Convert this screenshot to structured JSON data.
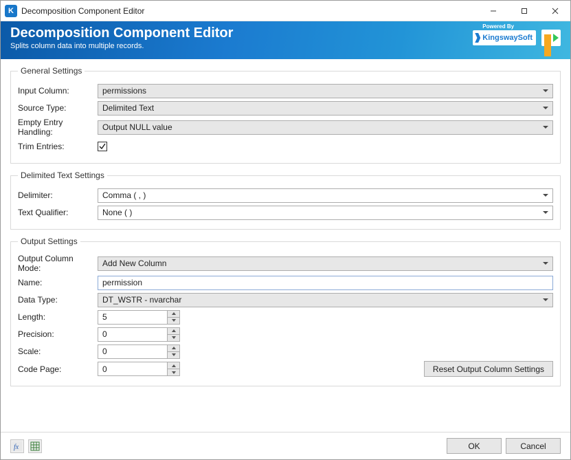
{
  "titlebar": {
    "app_initial": "K",
    "title": "Decomposition Component Editor"
  },
  "banner": {
    "title": "Decomposition Component Editor",
    "subtitle": "Splits column data into multiple records.",
    "powered_by": "Powered By",
    "brand": "KingswaySoft"
  },
  "general": {
    "legend": "General Settings",
    "input_column_label": "Input Column:",
    "input_column_value": "permissions",
    "source_type_label": "Source Type:",
    "source_type_value": "Delimited Text",
    "empty_handling_label": "Empty Entry Handling:",
    "empty_handling_value": "Output NULL value",
    "trim_label": "Trim Entries:",
    "trim_checked": true
  },
  "delimited": {
    "legend": "Delimited Text Settings",
    "delimiter_label": "Delimiter:",
    "delimiter_value": "Comma ( , )",
    "qualifier_label": "Text Qualifier:",
    "qualifier_value": "None (  )"
  },
  "output": {
    "legend": "Output Settings",
    "mode_label": "Output Column Mode:",
    "mode_value": "Add New Column",
    "name_label": "Name:",
    "name_value": "permission",
    "datatype_label": "Data Type:",
    "datatype_value": "DT_WSTR - nvarchar",
    "length_label": "Length:",
    "length_value": "5",
    "precision_label": "Precision:",
    "precision_value": "0",
    "scale_label": "Scale:",
    "scale_value": "0",
    "codepage_label": "Code Page:",
    "codepage_value": "0",
    "reset_label": "Reset Output Column Settings"
  },
  "footer": {
    "ok": "OK",
    "cancel": "Cancel"
  }
}
